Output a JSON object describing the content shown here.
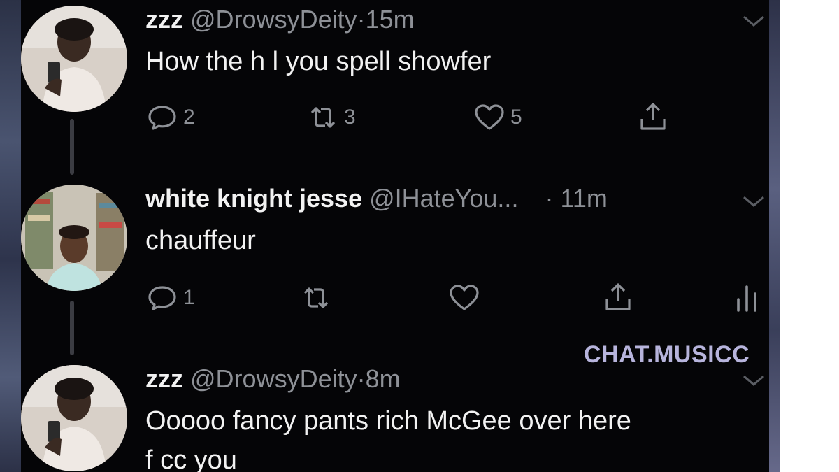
{
  "tweets": [
    {
      "name": "zzz",
      "handle": "@DrowsyDeity",
      "separator": "·",
      "time": "15m",
      "text": "How the h  l you spell showfer",
      "replies": "2",
      "retweets": "3",
      "likes": "5"
    },
    {
      "name": "white knight jesse",
      "handle": "@IHateYou...",
      "separator": "·",
      "time": "11m",
      "text": "chauffeur",
      "replies": "1"
    },
    {
      "name": "zzz",
      "handle": "@DrowsyDeity",
      "separator": "·",
      "time": "8m",
      "text": "Ooooo fancy pants rich McGee over here",
      "text2": "f  cc you"
    }
  ],
  "watermark": "CHAT.MUSICC",
  "colors": {
    "background": "#050507",
    "primary_text": "#f2f2f2",
    "secondary_text": "#8e9197",
    "watermark": "#b7b4dc"
  },
  "icons": [
    "reply-icon",
    "retweet-icon",
    "like-icon",
    "share-icon",
    "analytics-icon",
    "chevron-down-icon"
  ]
}
